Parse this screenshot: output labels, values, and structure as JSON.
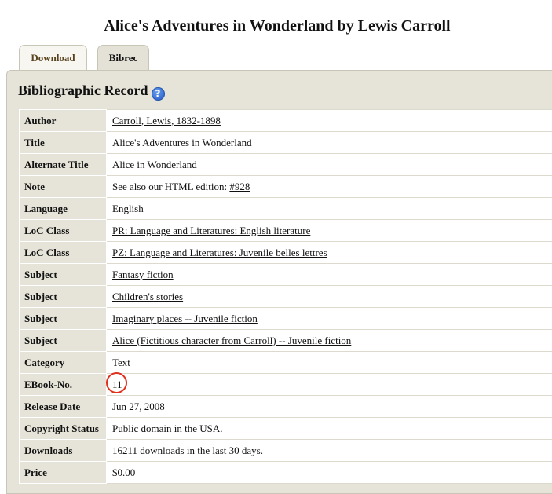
{
  "page": {
    "title": "Alice's Adventures in Wonderland by Lewis Carroll"
  },
  "tabs": [
    {
      "label": "Download"
    },
    {
      "label": "Bibrec"
    }
  ],
  "section": {
    "heading": "Bibliographic Record",
    "help_icon": "question-mark-icon",
    "help_glyph": "?"
  },
  "record": {
    "rows": [
      {
        "label": "Author",
        "value": "Carroll, Lewis, 1832-1898"
      },
      {
        "label": "Title",
        "value": "Alice's Adventures in Wonderland"
      },
      {
        "label": "Alternate Title",
        "value": "Alice in Wonderland"
      },
      {
        "label": "Note",
        "value": "See also our HTML edition: ",
        "link": "#928"
      },
      {
        "label": "Language",
        "value": "English"
      },
      {
        "label": "LoC Class",
        "value": "PR: Language and Literatures: English literature"
      },
      {
        "label": "LoC Class",
        "value": "PZ: Language and Literatures: Juvenile belles lettres"
      },
      {
        "label": "Subject",
        "value": "Fantasy fiction"
      },
      {
        "label": "Subject",
        "value": "Children's stories"
      },
      {
        "label": "Subject",
        "value": "Imaginary places -- Juvenile fiction"
      },
      {
        "label": "Subject",
        "value": "Alice (Fictitious character from Carroll) -- Juvenile fiction"
      },
      {
        "label": "Category",
        "value": "Text"
      },
      {
        "label": "EBook-No.",
        "value": "11"
      },
      {
        "label": "Release Date",
        "value": "Jun 27, 2008"
      },
      {
        "label": "Copyright Status",
        "value": "Public domain in the USA."
      },
      {
        "label": "Downloads",
        "value": "16211 downloads in the last 30 days."
      },
      {
        "label": "Price",
        "value": "$0.00"
      }
    ]
  },
  "colors": {
    "panel_bg": "#e6e4d8",
    "highlight_circle": "#e0301e",
    "help_icon": "#1a50c0"
  }
}
